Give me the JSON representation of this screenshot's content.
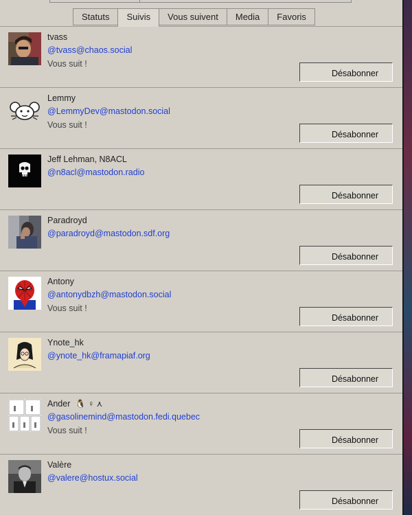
{
  "tabs": [
    "Statuts",
    "Suivis",
    "Vous suivent",
    "Media",
    "Favoris"
  ],
  "follow_rows": [
    {
      "name": "tvass",
      "handle": "@tvass@chaos.social",
      "follows_you": "Vous suit !",
      "button": "Désabonner"
    },
    {
      "name": "Lemmy",
      "handle": "@LemmyDev@mastodon.social",
      "follows_you": "Vous suit !",
      "button": "Désabonner"
    },
    {
      "name": "Jeff Lehman, N8ACL",
      "handle": "@n8acl@mastodon.radio",
      "follows_you": "",
      "button": "Désabonner"
    },
    {
      "name": "Paradroyd",
      "handle": "@paradroyd@mastodon.sdf.org",
      "follows_you": "",
      "button": "Désabonner"
    },
    {
      "name": "Antony",
      "handle": "@antonydbzh@mastodon.social",
      "follows_you": "Vous suit !",
      "button": "Désabonner"
    },
    {
      "name": "Ynote_hk",
      "handle": "@ynote_hk@framapiaf.org",
      "follows_you": "",
      "button": "Désabonner"
    },
    {
      "name": "Ander",
      "name_badges": "🐧 ♀ ⋏",
      "handle": "@gasolinemind@mastodon.fedi.quebec",
      "follows_you": "Vous suit !",
      "button": "Désabonner"
    },
    {
      "name": "Valère",
      "handle": "@valere@hostux.social",
      "follows_you": "",
      "button": "Désabonner"
    }
  ],
  "colors": {
    "background": "#d4d0c8",
    "handle_link": "#1f3fd1",
    "separator": "#9c9a94"
  },
  "icons": [
    "avatar-tvass",
    "avatar-lemmy-mouse",
    "avatar-punisher-skull",
    "avatar-paradroyd",
    "avatar-spiderman",
    "avatar-ynote-drawing",
    "avatar-ander-comic",
    "avatar-valere"
  ]
}
